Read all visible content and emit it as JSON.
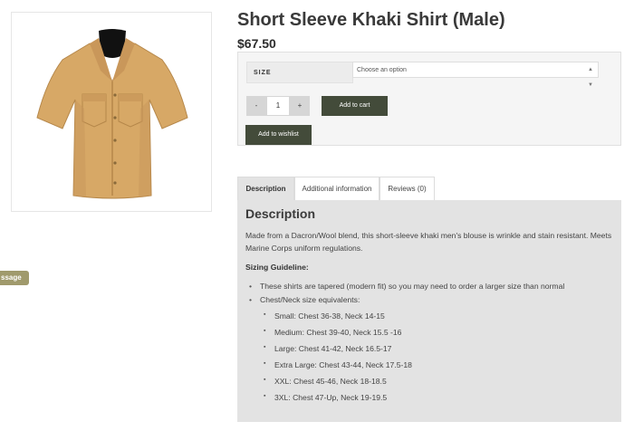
{
  "product": {
    "title": "Short Sleeve Khaki Shirt (Male)",
    "price": "$67.50",
    "image_icon": "khaki-shirt-image"
  },
  "side_tab": {
    "label": "ssage"
  },
  "form": {
    "size_label": "SIZE",
    "select_placeholder": "Choose an option",
    "qty_minus": "-",
    "qty_value": "1",
    "qty_plus": "+",
    "add_to_cart": "Add to cart",
    "add_to_wishlist": "Add to wishlist"
  },
  "tabs": [
    {
      "label": "Description",
      "active": true
    },
    {
      "label": "Additional information",
      "active": false
    },
    {
      "label": "Reviews (0)",
      "active": false
    }
  ],
  "description": {
    "heading": "Description",
    "text": "Made from a Dacron/Wool blend, this short-sleeve khaki men's blouse is wrinkle and stain resistant. Meets Marine Corps uniform regulations.",
    "sizing_heading": "Sizing Guideline:",
    "bullets": [
      "These shirts are tapered (modern fit) so you may need to order a larger size than normal",
      "Chest/Neck size equivalents:"
    ],
    "sizes": [
      "Small: Chest 36-38, Neck 14-15",
      "Medium: Chest 39-40, Neck 15.5 -16",
      "Large: Chest 41-42, Neck 16.5-17",
      "Extra Large: Chest 43-44, Neck 17.5-18",
      "XXL: Chest 45-46, Neck 18-18.5",
      "3XL: Chest 47-Up, Neck 19-19.5"
    ]
  },
  "colors": {
    "button_dark": "#434b3a",
    "side_tab": "#a09a6c",
    "shirt": "#d7a866",
    "panel": "#e3e3e3"
  }
}
